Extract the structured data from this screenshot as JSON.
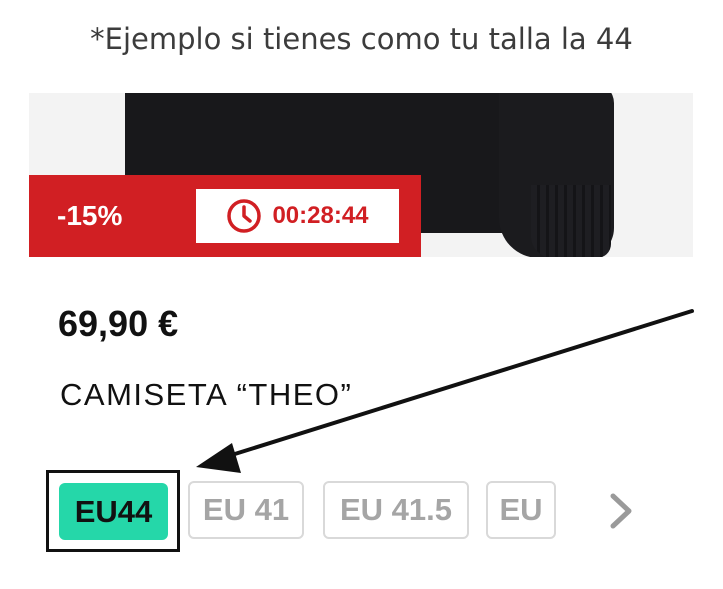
{
  "caption": "*Ejemplo si tienes como tu talla la 44",
  "promo": {
    "discount": "-15%",
    "timer": "00:28:44",
    "banner_color": "#d11f23"
  },
  "product": {
    "price": "69,90 €",
    "title": "CAMISETA “THEO”"
  },
  "sizes": {
    "selected": "EU44",
    "options": [
      "EU 41",
      "EU 41.5",
      "EU"
    ],
    "selected_color": "#25d7a9"
  },
  "icons": [
    "clock-icon",
    "chevron-right-icon",
    "arrow-annotation"
  ]
}
